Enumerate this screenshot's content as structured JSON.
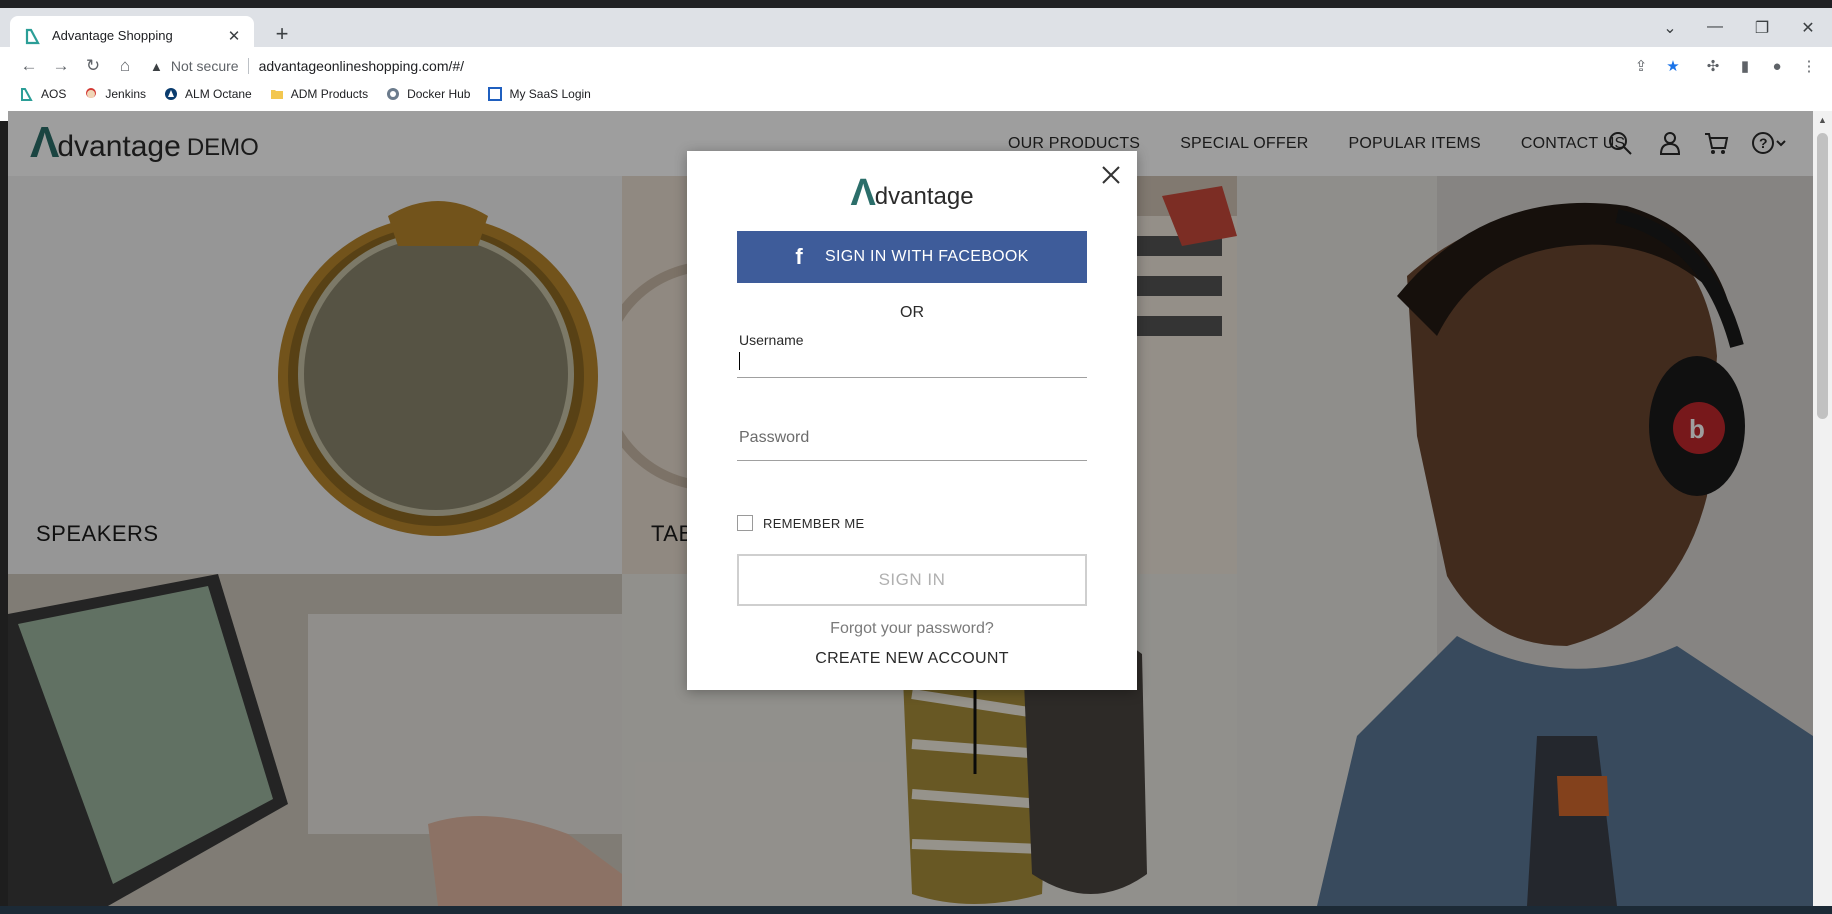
{
  "browser": {
    "tab_title": "Advantage Shopping",
    "address": {
      "security_text": "Not secure",
      "url": "advantageonlineshopping.com/#/"
    },
    "bookmarks": [
      {
        "label": "AOS",
        "icon": "aos-logo-icon"
      },
      {
        "label": "Jenkins",
        "icon": "jenkins-icon"
      },
      {
        "label": "ALM Octane",
        "icon": "alm-octane-icon"
      },
      {
        "label": "ADM Products",
        "icon": "folder-icon"
      },
      {
        "label": "Docker Hub",
        "icon": "docker-icon"
      },
      {
        "label": "My SaaS Login",
        "icon": "saas-icon"
      }
    ]
  },
  "site": {
    "logo_mark": "Λ",
    "logo_text": "dvantage",
    "logo_demo": "DEMO",
    "nav": [
      "OUR PRODUCTS",
      "SPECIAL OFFER",
      "POPULAR ITEMS",
      "CONTACT US"
    ],
    "categories": {
      "speakers": "SPEAKERS",
      "tablets": "TABLETS"
    }
  },
  "login_modal": {
    "logo_mark": "Λ",
    "logo_text": "dvantage",
    "facebook_icon": "f",
    "facebook_label": "SIGN IN WITH FACEBOOK",
    "or_text": "OR",
    "username_label": "Username",
    "username_value": "",
    "password_placeholder": "Password",
    "remember_label": "REMEMBER ME",
    "remember_checked": false,
    "signin_label": "SIGN IN",
    "forgot_label": "Forgot your password?",
    "create_account_label": "CREATE NEW ACCOUNT"
  },
  "colors": {
    "brand_teal": "#2b6e6a",
    "facebook_blue": "#3e5c9a"
  }
}
